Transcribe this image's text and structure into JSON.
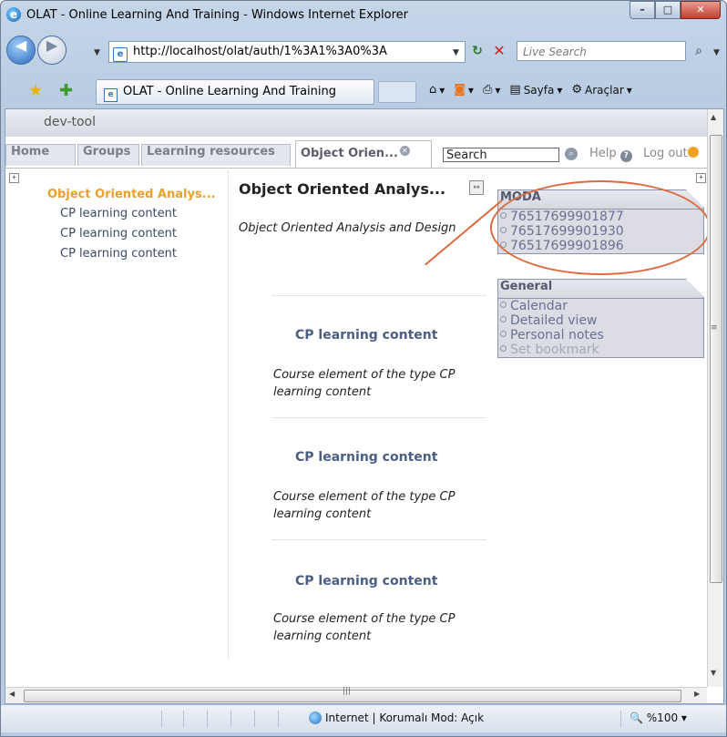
{
  "window": {
    "title": "OLAT - Online Learning And Training - Windows Internet Explorer"
  },
  "browser": {
    "address": "http://localhost/olat/auth/1%3A1%3A0%3A",
    "search_placeholder": "Live Search",
    "tab_title": "OLAT - Online Learning And Training",
    "commands": {
      "page": "Sayfa",
      "tools": "Araçlar"
    }
  },
  "olat": {
    "devbar": "dev-tool",
    "tabs": [
      "Home",
      "Groups",
      "Learning resources",
      "Object Orien..."
    ],
    "search_value": "Search",
    "help": "Help",
    "logout": "Log out"
  },
  "menu": {
    "root": "Object Oriented Analys...",
    "items": [
      "CP learning content",
      "CP learning content",
      "CP learning content"
    ]
  },
  "course": {
    "title": "Object Oriented Analys...",
    "description": "Object Oriented Analysis and Design",
    "elements": [
      {
        "title": "CP learning content",
        "desc": "Course element of the type CP learning content"
      },
      {
        "title": "CP learning content",
        "desc": "Course element of the type CP learning content"
      },
      {
        "title": "CP learning content",
        "desc": "Course element of the type CP learning content"
      }
    ]
  },
  "portlets": {
    "moda": {
      "title": "MODA",
      "items": [
        "76517699901877",
        "76517699901930",
        "76517699901896"
      ]
    },
    "general": {
      "title": "General",
      "items": [
        "Calendar",
        "Detailed view",
        "Personal notes",
        "Set bookmark"
      ]
    }
  },
  "status": {
    "zone": "Internet | Korumalı Mod: Açık",
    "zoom": "%100"
  },
  "colors": {
    "accent_orange": "#eb9f2c",
    "highlight": "#e06a3f",
    "link_blue": "#4a5e86"
  }
}
